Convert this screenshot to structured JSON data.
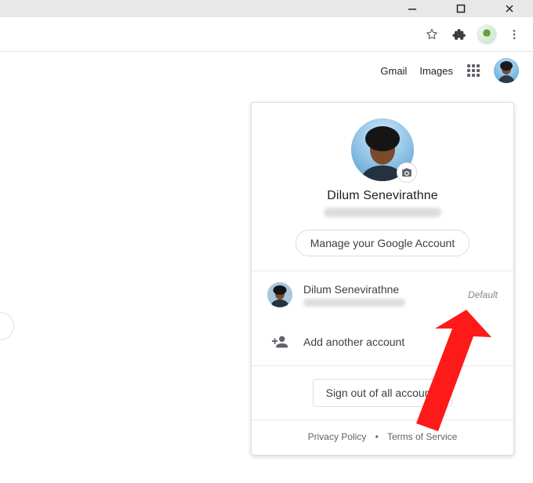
{
  "window": {
    "minimize_title": "Minimize",
    "maximize_title": "Maximize",
    "close_title": "Close"
  },
  "toolbar": {
    "star_title": "Bookmark",
    "extensions_title": "Extensions",
    "profile_title": "Profile",
    "menu_title": "Menu"
  },
  "header": {
    "gmail_label": "Gmail",
    "images_label": "Images",
    "apps_title": "Google apps",
    "avatar_title": "Account"
  },
  "card": {
    "camera_title": "Change photo",
    "display_name": "Dilum Senevirathne",
    "manage_label": "Manage your Google Account",
    "default_tag": "Default",
    "accounts": [
      {
        "name": "Dilum Senevirathne"
      }
    ],
    "add_label": "Add another account",
    "signout_label": "Sign out of all accounts",
    "privacy_label": "Privacy Policy",
    "terms_label": "Terms of Service"
  }
}
